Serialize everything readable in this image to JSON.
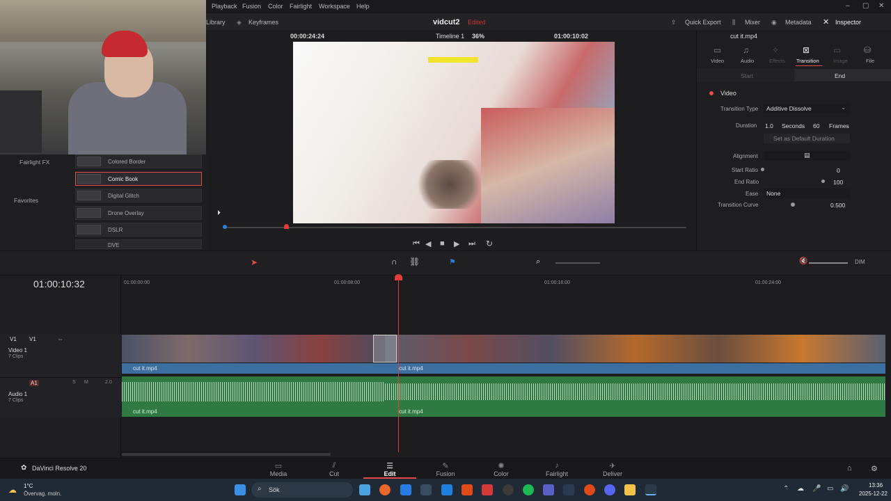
{
  "menu": [
    "Playback",
    "Fusion",
    "Color",
    "Fairlight",
    "Workspace",
    "Help"
  ],
  "window_controls": [
    "–",
    "▢",
    "✕"
  ],
  "toolbar": {
    "library": "Library",
    "keyframes": "Keyframes",
    "project_name": "vidcut2",
    "edited_status": "Edited",
    "quick_export": "Quick Export",
    "mixer": "Mixer",
    "metadata": "Metadata",
    "inspector": "Inspector"
  },
  "viewer": {
    "zoom": "36%",
    "source_timecode": "00:00:24:24",
    "timeline_name": "Timeline 1",
    "timeline_timecode": "01:00:10:02"
  },
  "fx_panel": {
    "categories": [
      "Fairlight FX",
      "Favorites"
    ],
    "items": [
      "Colored Border",
      "Comic Book",
      "Digital Glitch",
      "Drone Overlay",
      "DSLR",
      "DVE"
    ]
  },
  "inspector": {
    "clip_name": "cut it.mp4",
    "tabs": [
      "Video",
      "Audio",
      "Effects",
      "Transition",
      "Image",
      "File"
    ],
    "subtabs": [
      "Start",
      "End"
    ],
    "section": "Video",
    "transition_type_label": "Transition Type",
    "transition_type": "Additive Dissolve",
    "duration_label": "Duration",
    "duration_seconds": "1.0",
    "seconds_label": "Seconds",
    "duration_frames": "60",
    "frames_label": "Frames",
    "set_default": "Set as Default Duration",
    "alignment_label": "Alignment",
    "start_ratio_label": "Start Ratio",
    "start_ratio": "0",
    "end_ratio_label": "End Ratio",
    "end_ratio": "100",
    "ease_label": "Ease",
    "ease": "None",
    "curve_label": "Transition Curve",
    "curve": "0.500"
  },
  "timeline": {
    "current_timecode": "01:00:10:32",
    "ruler": [
      "01:00:00:00",
      "01:00:08:00",
      "01:00:16:00",
      "01:00:24:00"
    ],
    "dim": "DIM",
    "video_track": {
      "id": "V1",
      "name": "Video 1",
      "clips": "7 Clips",
      "clip_name": "cut it.mp4"
    },
    "audio_track": {
      "id": "A1",
      "name": "Audio 1",
      "clips": "7 Clips",
      "level": "2.0",
      "clip_name": "cut it.mp4",
      "solo": "S",
      "mute": "M"
    }
  },
  "app_name": "DaVinci Resolve 20",
  "pages": [
    "Media",
    "Cut",
    "Edit",
    "Fusion",
    "Color",
    "Fairlight",
    "Deliver"
  ],
  "active_page": "Edit",
  "taskbar": {
    "weather_temp": "1°C",
    "weather_desc": "Övervag. moln.",
    "search_placeholder": "Sök",
    "time": "13:36",
    "date": "2025-12-22"
  },
  "colors": {
    "accent": "#e64b4b",
    "playhead": "#e23b3b",
    "video_clip": "#3d6ea0",
    "audio_clip": "#2f7a42"
  }
}
